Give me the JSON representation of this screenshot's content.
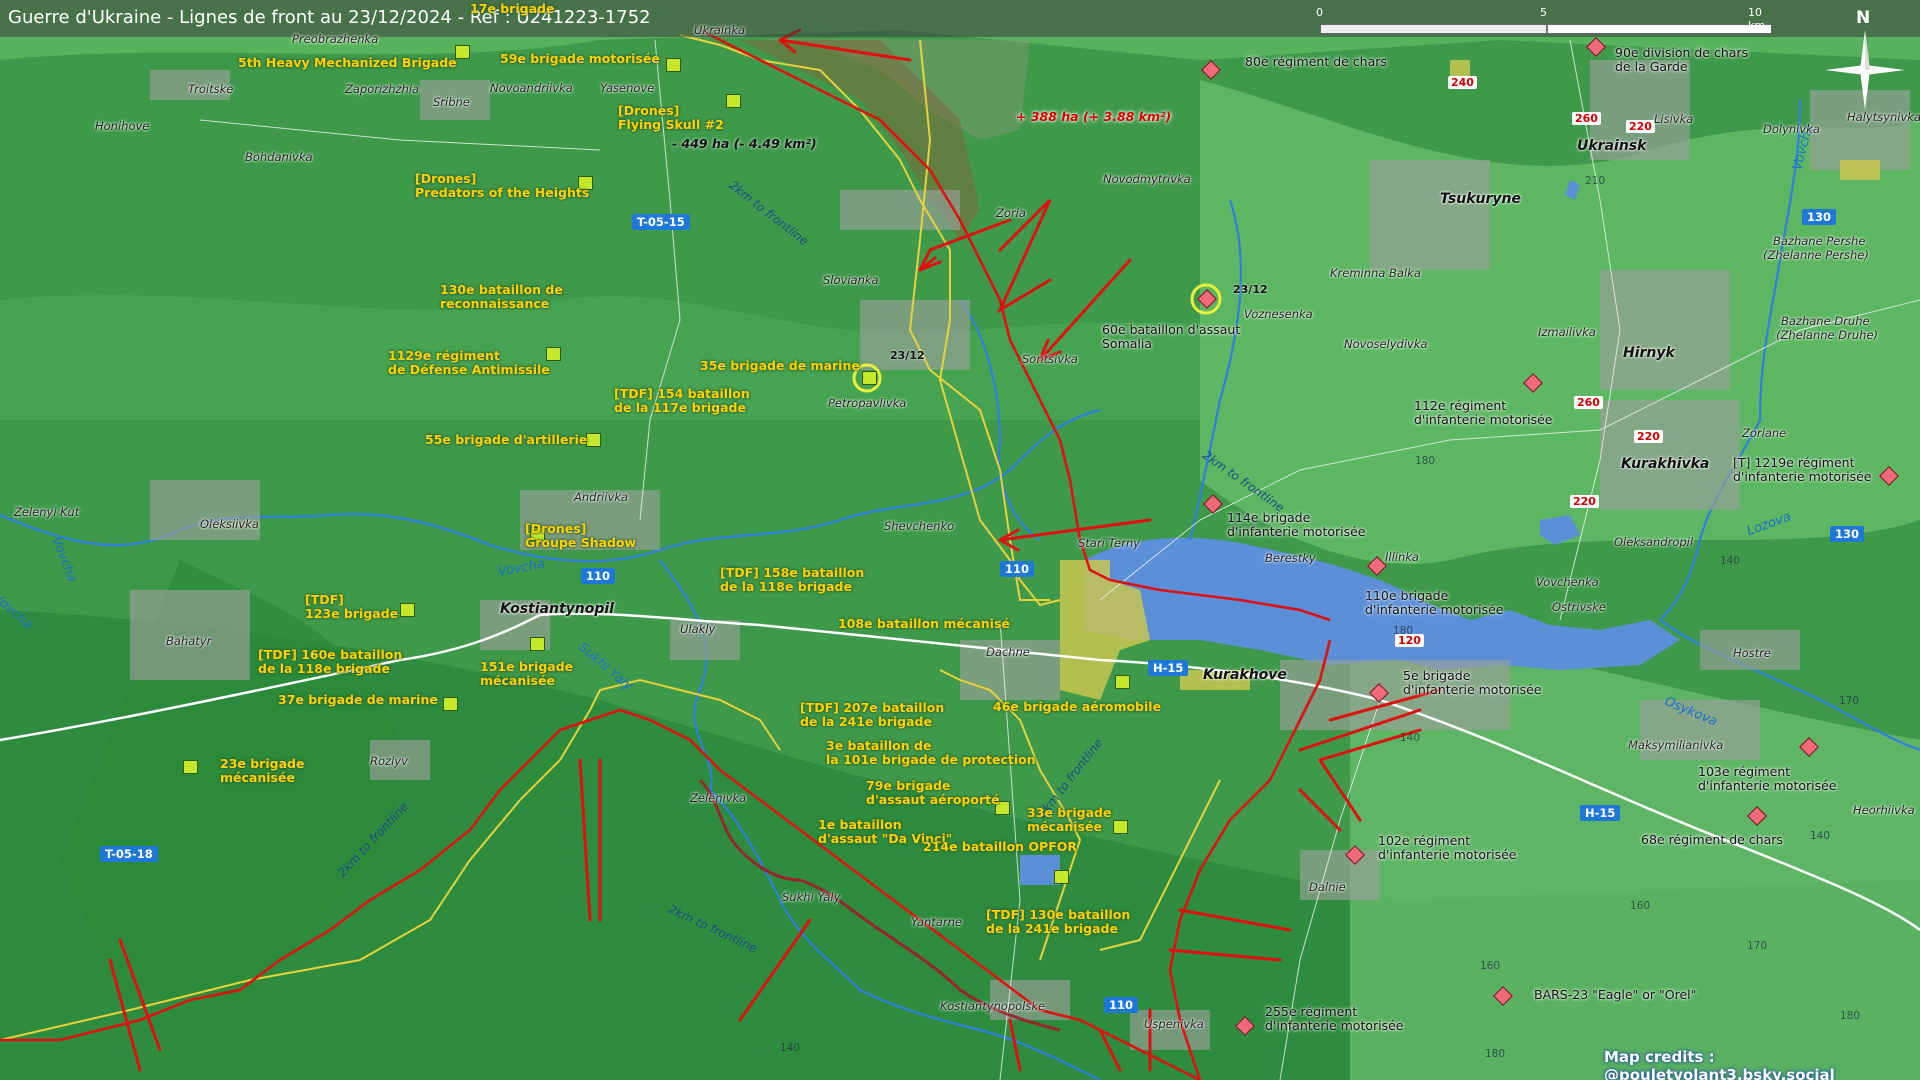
{
  "title": "Guerre d'Ukraine - Lignes de front au 23/12/2024 - Ref : U241223-1752",
  "scale_bar": {
    "ticks": [
      "0",
      "5",
      "10 km"
    ]
  },
  "north_label": "N",
  "credits": "Map credits : @pouletvolant3.bsky.social",
  "colors": {
    "ua_unit": "#ffd200",
    "ru_front": "#e01010",
    "ua_line": "#e8d23a",
    "water": "#5b8fd8",
    "road_sign": "#1f78d8"
  },
  "territory_changes": {
    "gain": "+ 388 ha (+ 3.88 km²)",
    "loss": "- 449 ha (- 4.49 km²)"
  },
  "update_date": "23/12",
  "guides": [
    "2km to frontline",
    "2km to frontline",
    "2km to frontline",
    "2km to frontline",
    "2km to frontline"
  ],
  "rivers": [
    "Vovcha",
    "Vovcha",
    "Vovcha",
    "Sukhi Yaly",
    "Lozova",
    "Osykova"
  ],
  "road_signs": [
    "T-05-15",
    "T-05-18",
    "H-15",
    "H-15",
    "110",
    "110",
    "110",
    "130",
    "240",
    "260",
    "220",
    "260",
    "220",
    "220",
    "120"
  ],
  "elevations": [
    "210",
    "180",
    "180",
    "140",
    "140",
    "170",
    "160",
    "170",
    "140",
    "180",
    "160",
    "140",
    "180"
  ],
  "places": [
    "Preobrazhenka",
    "Troitske",
    "Zaporizhzhia",
    "Novoandriivka",
    "Yasenove",
    "Sribne",
    "Honihove",
    "Bohdanivka",
    "Ukrainka",
    "Slovianka",
    "Petropavlivka",
    "Zoria",
    "Sontsivka",
    "Novodmytrivka",
    "Tsukuryne",
    "Kreminna Balka",
    "Voznesenka",
    "Novoselydivka",
    "Izmailivka",
    "Hirnyk",
    "Ukrainsk",
    "Lisivka",
    "Dolynivka",
    "Halytsynivka",
    "Bazhane Pershe",
    "(Zhelanne Pershe)",
    "Bazhane Druhe",
    "(Zhelanne Druhe)",
    "Zoriane",
    "Kurakhivka",
    "Oleksandropil",
    "Berestky",
    "Illinka",
    "Vovchenka",
    "Ostrivske",
    "Hostre",
    "Kurakhove",
    "Stari Terny",
    "Shevchenko",
    "Andriivka",
    "Oleksiivka",
    "Zelenyi Kut",
    "Kostiantynopil",
    "Bahatyr",
    "Ulakly",
    "Dachne",
    "Rozlyv",
    "Zelenivka",
    "Sukhi Yaly",
    "Yantarne",
    "Kostiantynopolske",
    "Uspenivka",
    "Dalnie",
    "Maksymilianivka",
    "Heorhiivka"
  ],
  "ua_units": [
    "17e brigade",
    "5th Heavy Mechanized Brigade",
    "59e brigade motorisée",
    "[Drones]\nFlying Skull #2",
    "[Drones]\nPredators of the Heights",
    "130e bataillon de\nreconnaissance",
    "1129e régiment\nde Défense Antimissile",
    "35e brigade de marine",
    "[TDF] 154 bataillon\nde la 117e brigade",
    "55e brigade d'artillerie",
    "[Drones]\nGroupe Shadow",
    "[TDF] 158e bataillon\nde la 118e brigade",
    "[TDF]\n123e brigade",
    "[TDF] 160e bataillon\nde la 118e brigade",
    "151e brigade\nmécanisée",
    "37e brigade de marine",
    "23e brigade\nmécanisée",
    "108e bataillon mécanisé",
    "46e brigade aéromobile",
    "[TDF] 207e bataillon\nde la 241e brigade",
    "3e bataillon de\nla 101e brigade de protection",
    "79e brigade\nd'assaut aéroporté",
    "33e brigade\nmécanisée",
    "1e bataillon\nd'assaut \"Da Vinci\"",
    "214e bataillon OPFOR",
    "[TDF] 130e bataillon\nde la 241e brigade"
  ],
  "ru_units": [
    "80e régiment de chars",
    "90e division de chars\nde la Garde",
    "60e bataillon d'assaut\nSomalia",
    "112e régiment\nd'infanterie motorisée",
    "[T] 1219e régiment\nd'infanterie motorisée",
    "114e brigade\nd'infanterie motorisée",
    "110e brigade\nd'infanterie motorisée",
    "5e brigade\nd'infanterie motorisée",
    "103e régiment\nd'infanterie motorisée",
    "102e régiment\nd'infanterie motorisée",
    "68e régiment de chars",
    "255e régiment\nd'infanterie motorisée",
    "BARS-23 \"Eagle\" or \"Orel\""
  ]
}
